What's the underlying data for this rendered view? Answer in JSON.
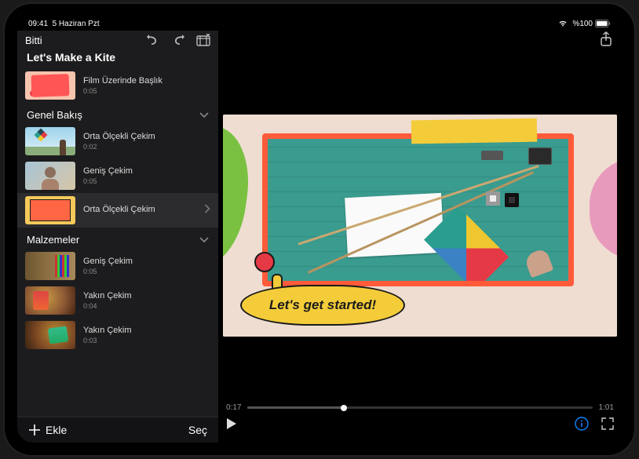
{
  "status": {
    "time": "09:41",
    "date": "5 Haziran Pzt",
    "battery": "%100"
  },
  "header": {
    "done": "Bitti",
    "title": "Let's Make a Kite"
  },
  "title_clip": {
    "label": "Film Üzerinde Başlık",
    "duration": "0:05"
  },
  "sections": [
    {
      "name": "Genel Bakış",
      "clips": [
        {
          "label": "Orta Ölçekli Çekim",
          "duration": "0:02",
          "thumb": "t-kite"
        },
        {
          "label": "Geniş Çekim",
          "duration": "0:05",
          "thumb": "t-person"
        },
        {
          "label": "Orta Ölçekli Çekim",
          "duration": "",
          "thumb": "t-collage",
          "selected": true,
          "marker": true
        }
      ]
    },
    {
      "name": "Malzemeler",
      "clips": [
        {
          "label": "Geniş Çekim",
          "duration": "0:05",
          "thumb": "t-shelf"
        },
        {
          "label": "Yakın Çekim",
          "duration": "0:04",
          "thumb": "t-close"
        },
        {
          "label": "Yakın Çekim",
          "duration": "0:03",
          "thumb": "t-close2"
        }
      ]
    }
  ],
  "footer": {
    "add": "Ekle",
    "select": "Seç"
  },
  "preview": {
    "bubble": "Let's get started!",
    "current": "0:17",
    "total": "1:01"
  }
}
